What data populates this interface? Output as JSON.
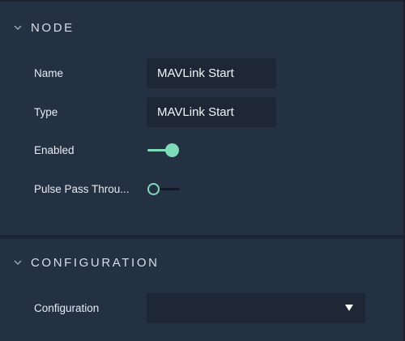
{
  "sections": {
    "node": {
      "title": "NODE",
      "fields": {
        "name": {
          "label": "Name",
          "value": "MAVLink Start"
        },
        "type": {
          "label": "Type",
          "value": "MAVLink Start"
        },
        "enabled": {
          "label": "Enabled",
          "checked": true
        },
        "pulse_pass_through": {
          "label": "Pulse Pass Throu...",
          "checked": false
        }
      }
    },
    "configuration": {
      "title": "CONFIGURATION",
      "fields": {
        "configuration": {
          "label": "Configuration",
          "selected": ""
        }
      }
    }
  },
  "colors": {
    "panel_bg": "#243142",
    "field_bg": "#1d2736",
    "accent": "#7fdcb8",
    "text": "#e6ebf2"
  },
  "icons": {
    "node_section_chevron": "chevron-down-icon",
    "configuration_section_chevron": "chevron-down-icon",
    "dropdown_caret": "caret-down-icon"
  }
}
